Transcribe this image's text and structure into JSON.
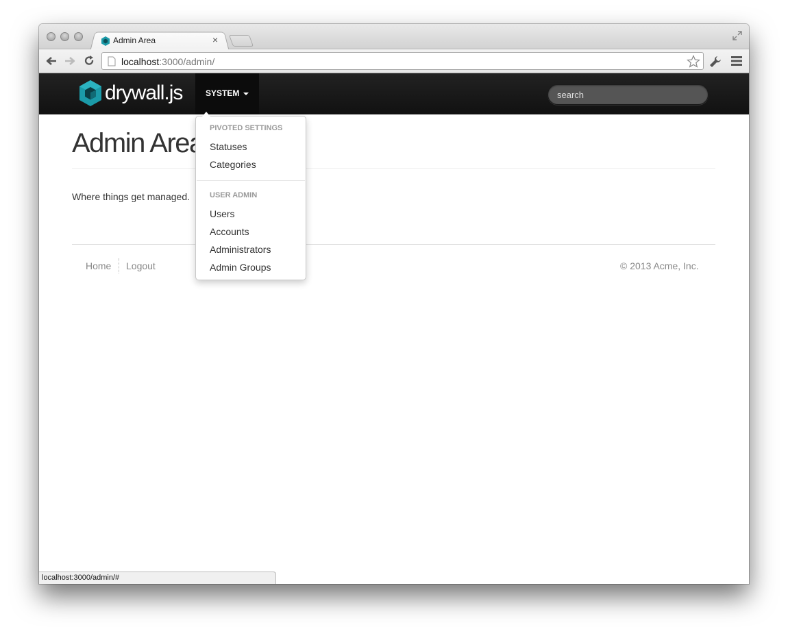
{
  "browser": {
    "tab_title": "Admin Area",
    "url_host": "localhost",
    "url_rest": ":3000/admin/",
    "status_url": "localhost:3000/admin/#"
  },
  "navbar": {
    "brand": "drywall.js",
    "menu_label": "SYSTEM",
    "search_placeholder": "search"
  },
  "dropdown": {
    "sections": [
      {
        "header": "PIVOTED SETTINGS",
        "items": [
          "Statuses",
          "Categories"
        ]
      },
      {
        "header": "USER ADMIN",
        "items": [
          "Users",
          "Accounts",
          "Administrators",
          "Admin Groups"
        ]
      }
    ]
  },
  "page": {
    "title": "Admin Area",
    "lead": "Where things get managed."
  },
  "footer": {
    "links": [
      "Home",
      "Logout"
    ],
    "copyright": "© 2013 Acme, Inc."
  },
  "colors": {
    "brand_teal": "#1b9aa8",
    "navbar_bg": "#1b1b1b"
  }
}
